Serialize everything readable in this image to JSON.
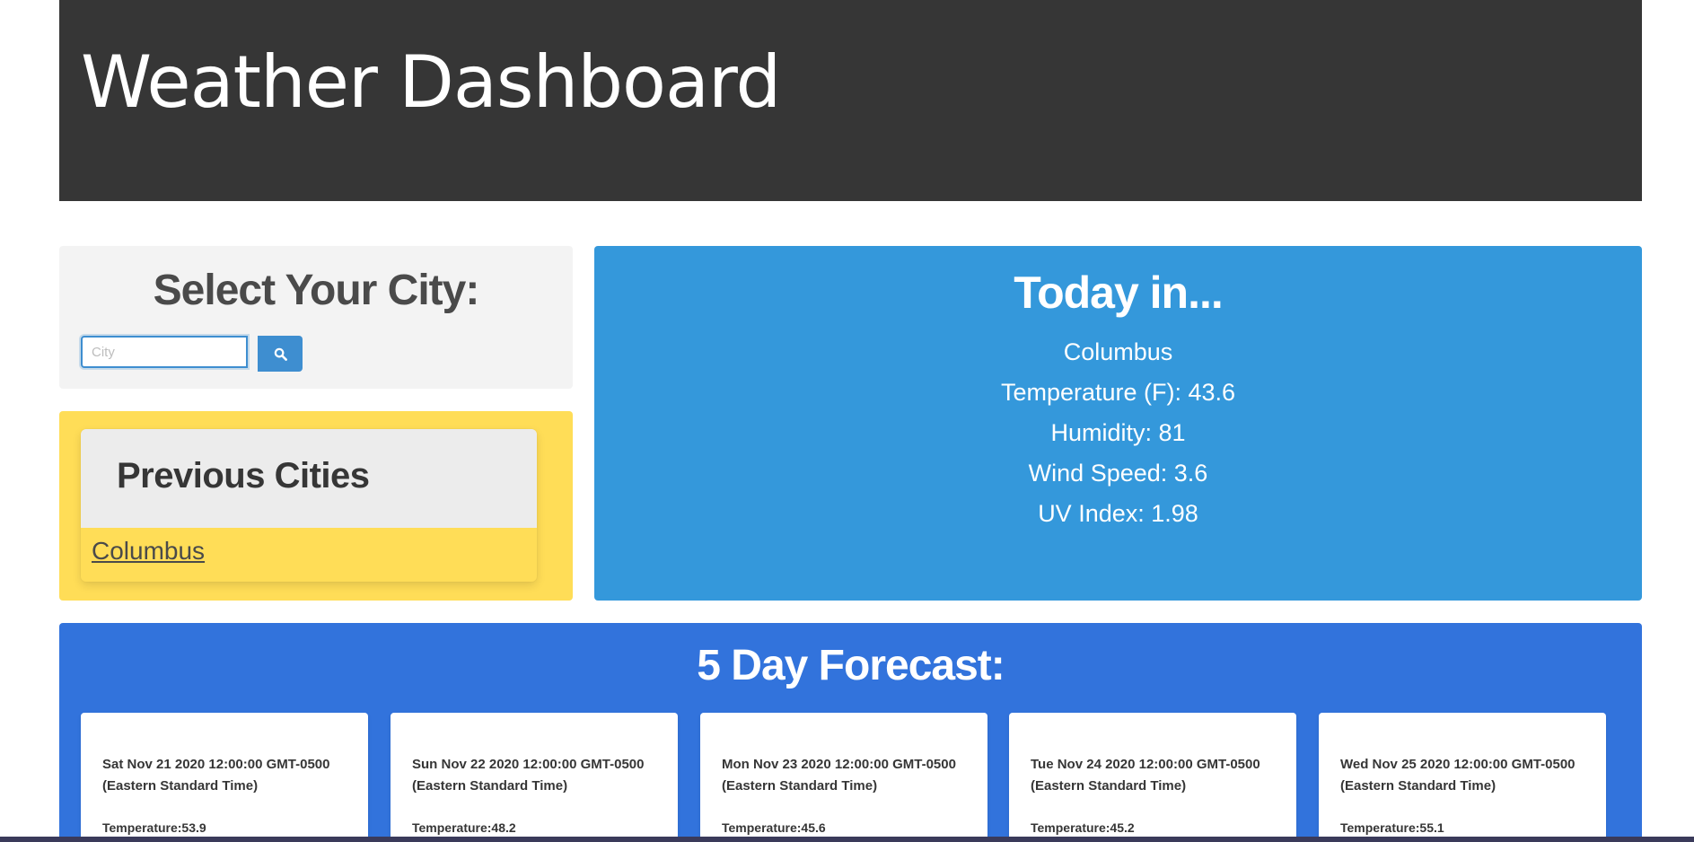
{
  "header": {
    "title": "Weather Dashboard"
  },
  "search": {
    "title": "Select Your City:",
    "placeholder": "City",
    "value": "",
    "button_icon": "search-icon"
  },
  "previous": {
    "title": "Previous Cities",
    "cities": [
      "Columbus"
    ]
  },
  "today": {
    "title": "Today in...",
    "city": "Columbus",
    "temperature": "Temperature (F): 43.6",
    "humidity": "Humidity: 81",
    "wind": "Wind Speed: 3.6",
    "uv": "UV Index: 1.98"
  },
  "forecast": {
    "title": "5 Day Forecast:",
    "days": [
      {
        "date": "Sat Nov 21 2020 12:00:00 GMT-0500 (Eastern Standard Time)",
        "temp": "Temperature:53.9"
      },
      {
        "date": "Sun Nov 22 2020 12:00:00 GMT-0500 (Eastern Standard Time)",
        "temp": "Temperature:48.2"
      },
      {
        "date": "Mon Nov 23 2020 12:00:00 GMT-0500 (Eastern Standard Time)",
        "temp": "Temperature:45.6"
      },
      {
        "date": "Tue Nov 24 2020 12:00:00 GMT-0500 (Eastern Standard Time)",
        "temp": "Temperature:45.2"
      },
      {
        "date": "Wed Nov 25 2020 12:00:00 GMT-0500 (Eastern Standard Time)",
        "temp": "Temperature:55.1"
      }
    ]
  },
  "colors": {
    "hero": "#363636",
    "today_panel": "#3498db",
    "forecast_panel": "#3273dc",
    "previous_panel": "#ffdd57",
    "search_panel": "#f3f3f3",
    "button": "#3e8ed0"
  }
}
